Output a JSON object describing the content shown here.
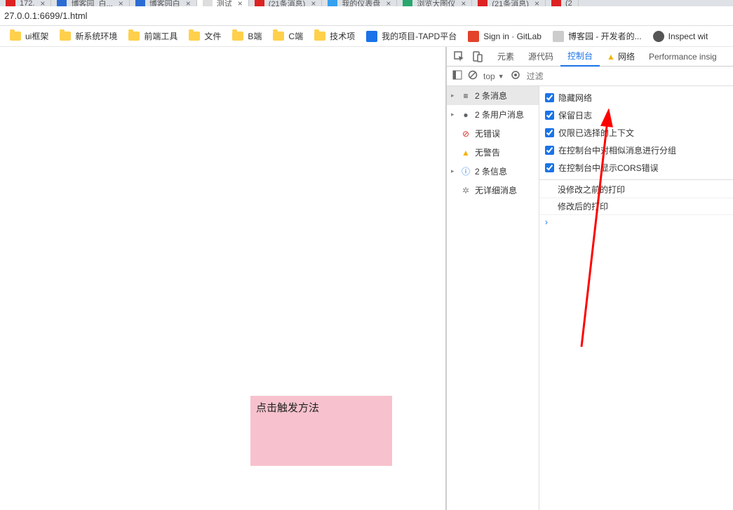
{
  "tabs": [
    {
      "label": "172.",
      "favColor": "#d22"
    },
    {
      "label": "博客园_白...",
      "favColor": "#2b6cd4"
    },
    {
      "label": "博客园白",
      "favColor": "#2b6cd4"
    },
    {
      "label": "测试",
      "favColor": "#555",
      "active": true
    },
    {
      "label": "(21条消息)",
      "favColor": "#d22"
    },
    {
      "label": "我的仪表盘",
      "favColor": "#35a0ee"
    },
    {
      "label": "浏览大图仪",
      "favColor": "#2aa76f"
    },
    {
      "label": "(21条消息)",
      "favColor": "#d22"
    },
    {
      "label": "(2",
      "favColor": "#d22"
    }
  ],
  "address": "27.0.0.1:6699/1.html",
  "bookmarks": {
    "folders": [
      "ui框架",
      "新系统环境",
      "前端工具",
      "文件",
      "B端",
      "C端",
      "技术项"
    ],
    "links": [
      {
        "label": "我的项目-TAPD平台",
        "color": "#1a73e8"
      },
      {
        "label": "Sign in · GitLab",
        "color": "#e2432a"
      },
      {
        "label": "博客园 - 开发者的...",
        "color": "#333"
      },
      {
        "label": "Inspect wit",
        "color": "#333"
      }
    ]
  },
  "page": {
    "pinkText": "点击触发方法"
  },
  "devtools": {
    "tabs": {
      "elements": "元素",
      "sources": "源代码",
      "console": "控制台",
      "network": "网络",
      "perf": "Performance insig"
    },
    "filter": {
      "ctx": "top",
      "eye": "",
      "placeholder": "过滤"
    },
    "sidebar": [
      {
        "icon": "≡",
        "label": "2 条消息",
        "expand": "▸",
        "sel": true
      },
      {
        "icon": "●",
        "label": "2 条用户消息",
        "expand": "▸",
        "iconColor": "#5f6368"
      },
      {
        "icon": "⊘",
        "label": "无错误",
        "iconColor": "#d93025"
      },
      {
        "icon": "▲",
        "label": "无警告",
        "iconColor": "#f4b400"
      },
      {
        "icon": "ⓘ",
        "label": "2 条信息",
        "expand": "▸",
        "iconColor": "#1a73e8"
      },
      {
        "icon": "⚙",
        "label": "无详细消息",
        "iconColor": "#888"
      }
    ],
    "options": [
      {
        "label": "隐藏网络",
        "checked": true
      },
      {
        "label": "保留日志",
        "checked": true
      },
      {
        "label": "仅限已选择的上下文",
        "checked": true
      },
      {
        "label": "在控制台中对相似消息进行分组",
        "checked": true
      },
      {
        "label": "在控制台中显示CORS错误",
        "checked": true
      }
    ],
    "logs": [
      "没修改之前的打印",
      "修改后的打印"
    ],
    "prompt": "›"
  }
}
